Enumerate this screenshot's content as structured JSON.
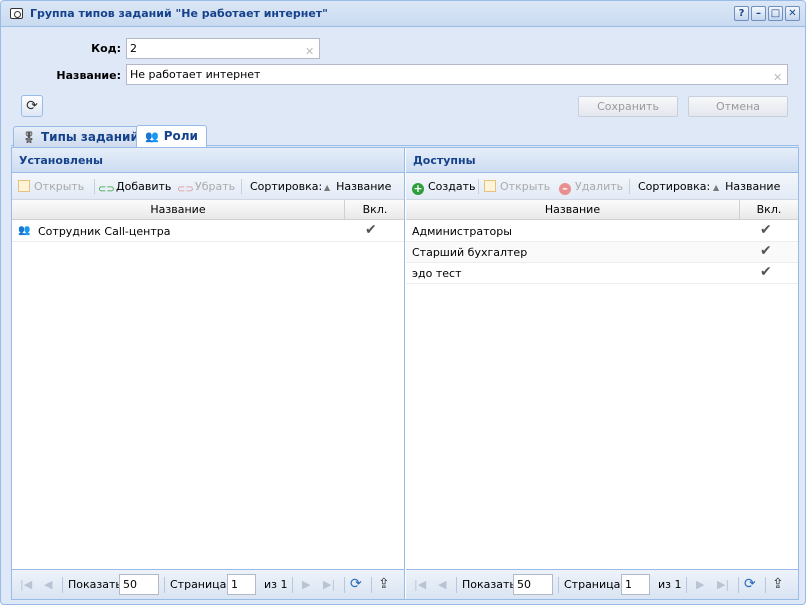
{
  "window": {
    "title": "Группа типов заданий \"Не работает интернет\"",
    "tools": [
      "?",
      "–",
      "□",
      "✕"
    ]
  },
  "form": {
    "code_label": "Код:",
    "code_value": "2",
    "name_label": "Название:",
    "name_value": "Не работает интернет",
    "save_label": "Сохранить",
    "cancel_label": "Отмена"
  },
  "tabs": [
    {
      "label": "Типы заданий",
      "icon": "medal-icon",
      "active": false
    },
    {
      "label": "Роли",
      "icon": "users-icon",
      "active": true
    }
  ],
  "left_panel": {
    "title": "Установлены",
    "toolbar": {
      "open": "Открыть",
      "add": "Добавить",
      "remove": "Убрать",
      "sort_label": "Сортировка:",
      "sort_value": "Название"
    },
    "columns": {
      "name": "Название",
      "enabled": "Вкл."
    },
    "rows": [
      {
        "name": "Сотрудник Call-центра",
        "enabled": "✔"
      }
    ]
  },
  "right_panel": {
    "title": "Доступны",
    "toolbar": {
      "create": "Создать",
      "open": "Открыть",
      "delete": "Удалить",
      "sort_label": "Сортировка:",
      "sort_value": "Название"
    },
    "columns": {
      "name": "Название",
      "enabled": "Вкл."
    },
    "rows": [
      {
        "name": "Администраторы",
        "enabled": "✔"
      },
      {
        "name": "Старший бухгалтер",
        "enabled": "✔"
      },
      {
        "name": "эдо тест",
        "enabled": "✔"
      }
    ]
  },
  "pager": {
    "show_label": "Показать",
    "page_size": "50",
    "page_label": "Страница",
    "page_value": "1",
    "of_label": "из 1"
  },
  "colors": {
    "accent": "#15428b",
    "border": "#99bbe8",
    "create_icon": "#2e9e3a",
    "delete_icon": "#e06666"
  }
}
